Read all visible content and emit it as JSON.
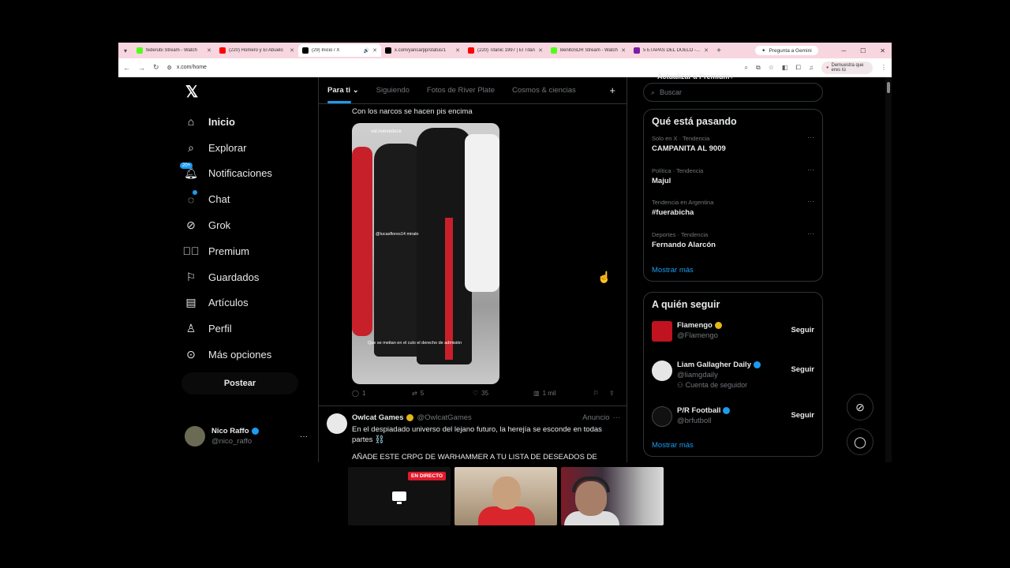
{
  "browser": {
    "tabs": [
      {
        "title": "federubi Stream - Watch",
        "color": "#53fc18",
        "active": false
      },
      {
        "title": "(220) Homero y El Abuelo",
        "color": "#ff0000",
        "active": false
      },
      {
        "title": "(29) Inicio / X",
        "color": "#000000",
        "active": true
      },
      {
        "title": "x.com/yancarpp/status/1",
        "color": "#000000",
        "active": false
      },
      {
        "title": "(220) Titanic 1997 | El Titán",
        "color": "#ff0000",
        "active": false
      },
      {
        "title": "BenitoSDR Stream - Watch",
        "color": "#53fc18",
        "active": false
      },
      {
        "title": "5 ETAPAS DEL DUELO - V...",
        "color": "#7a1fa2",
        "active": false
      }
    ],
    "gemini_label": "Pregunta a Gemini",
    "url": "x.com/home",
    "profile_label": "Demuestra que eres tú"
  },
  "nav": {
    "items": [
      {
        "label": "Inicio",
        "icon": "home-icon",
        "bold": true
      },
      {
        "label": "Explorar",
        "icon": "search-icon"
      },
      {
        "label": "Notificaciones",
        "icon": "bell-icon",
        "badge": "20+"
      },
      {
        "label": "Chat",
        "icon": "chat-icon"
      },
      {
        "label": "Grok",
        "icon": "grok-icon"
      },
      {
        "label": "Premium",
        "icon": "premium-icon"
      },
      {
        "label": "Guardados",
        "icon": "bookmark-icon"
      },
      {
        "label": "Artículos",
        "icon": "article-icon"
      },
      {
        "label": "Perfil",
        "icon": "person-icon"
      },
      {
        "label": "Más opciones",
        "icon": "more-circle-icon"
      }
    ],
    "post_label": "Postear",
    "account": {
      "name": "Nico Raffo",
      "handle": "@nico_raffo"
    }
  },
  "feed": {
    "tabs": [
      "Para ti",
      "Siguiendo",
      "Fotos de River Plate",
      "Cosmos & ciencias"
    ],
    "tweet1": {
      "text": "Con los narcos se hacen pis encima",
      "watermark": "val.nuevedoce",
      "tag": "@lucasflores14 miralo",
      "caption": "Que se meitan en el culo el derecho de admisión",
      "replies": "1",
      "reposts": "5",
      "likes": "35",
      "views": "1 mil"
    },
    "tweet2": {
      "name": "Owlcat Games",
      "handle": "@OwlcatGames",
      "ad_label": "Anuncio",
      "text": "En el despiadado universo del lejano futuro, la herejía se esconde en todas partes ⛓️",
      "text2": "AÑADE ESTE CRPG DE WARHAMMER A TU LISTA DE DESEADOS DE"
    }
  },
  "sidebar": {
    "premium_cut": "Actualizar a Premium+",
    "search_placeholder": "Buscar",
    "trends_title": "Qué está pasando",
    "trends": [
      {
        "category": "Solo en X · Tendencia",
        "title": "CAMPANITA AL 9009"
      },
      {
        "category": "Política · Tendencia",
        "title": "Majul"
      },
      {
        "category": "Tendencia en Argentina",
        "title": "#fuerabicha"
      },
      {
        "category": "Deportes · Tendencia",
        "title": "Fernando Alarcón"
      }
    ],
    "show_more": "Mostrar más",
    "follow_title": "A quién seguir",
    "follow": [
      {
        "name": "Flamengo",
        "handle": "@Flamengo",
        "extra": "",
        "color": "#c1121f",
        "verified": "gold"
      },
      {
        "name": "Liam Gallagher Daily",
        "handle": "@liamgdaily",
        "extra": "Cuenta de seguidor",
        "color": "#e6e6e6",
        "verified": "blue"
      },
      {
        "name": "P/R Football",
        "handle": "@brfutboll",
        "extra": "",
        "color": "#111111",
        "verified": "blue"
      }
    ],
    "follow_button": "Seguir",
    "follow_show_more": "Mostrar más"
  },
  "stream": {
    "live_label": "EN DIRECTO"
  }
}
